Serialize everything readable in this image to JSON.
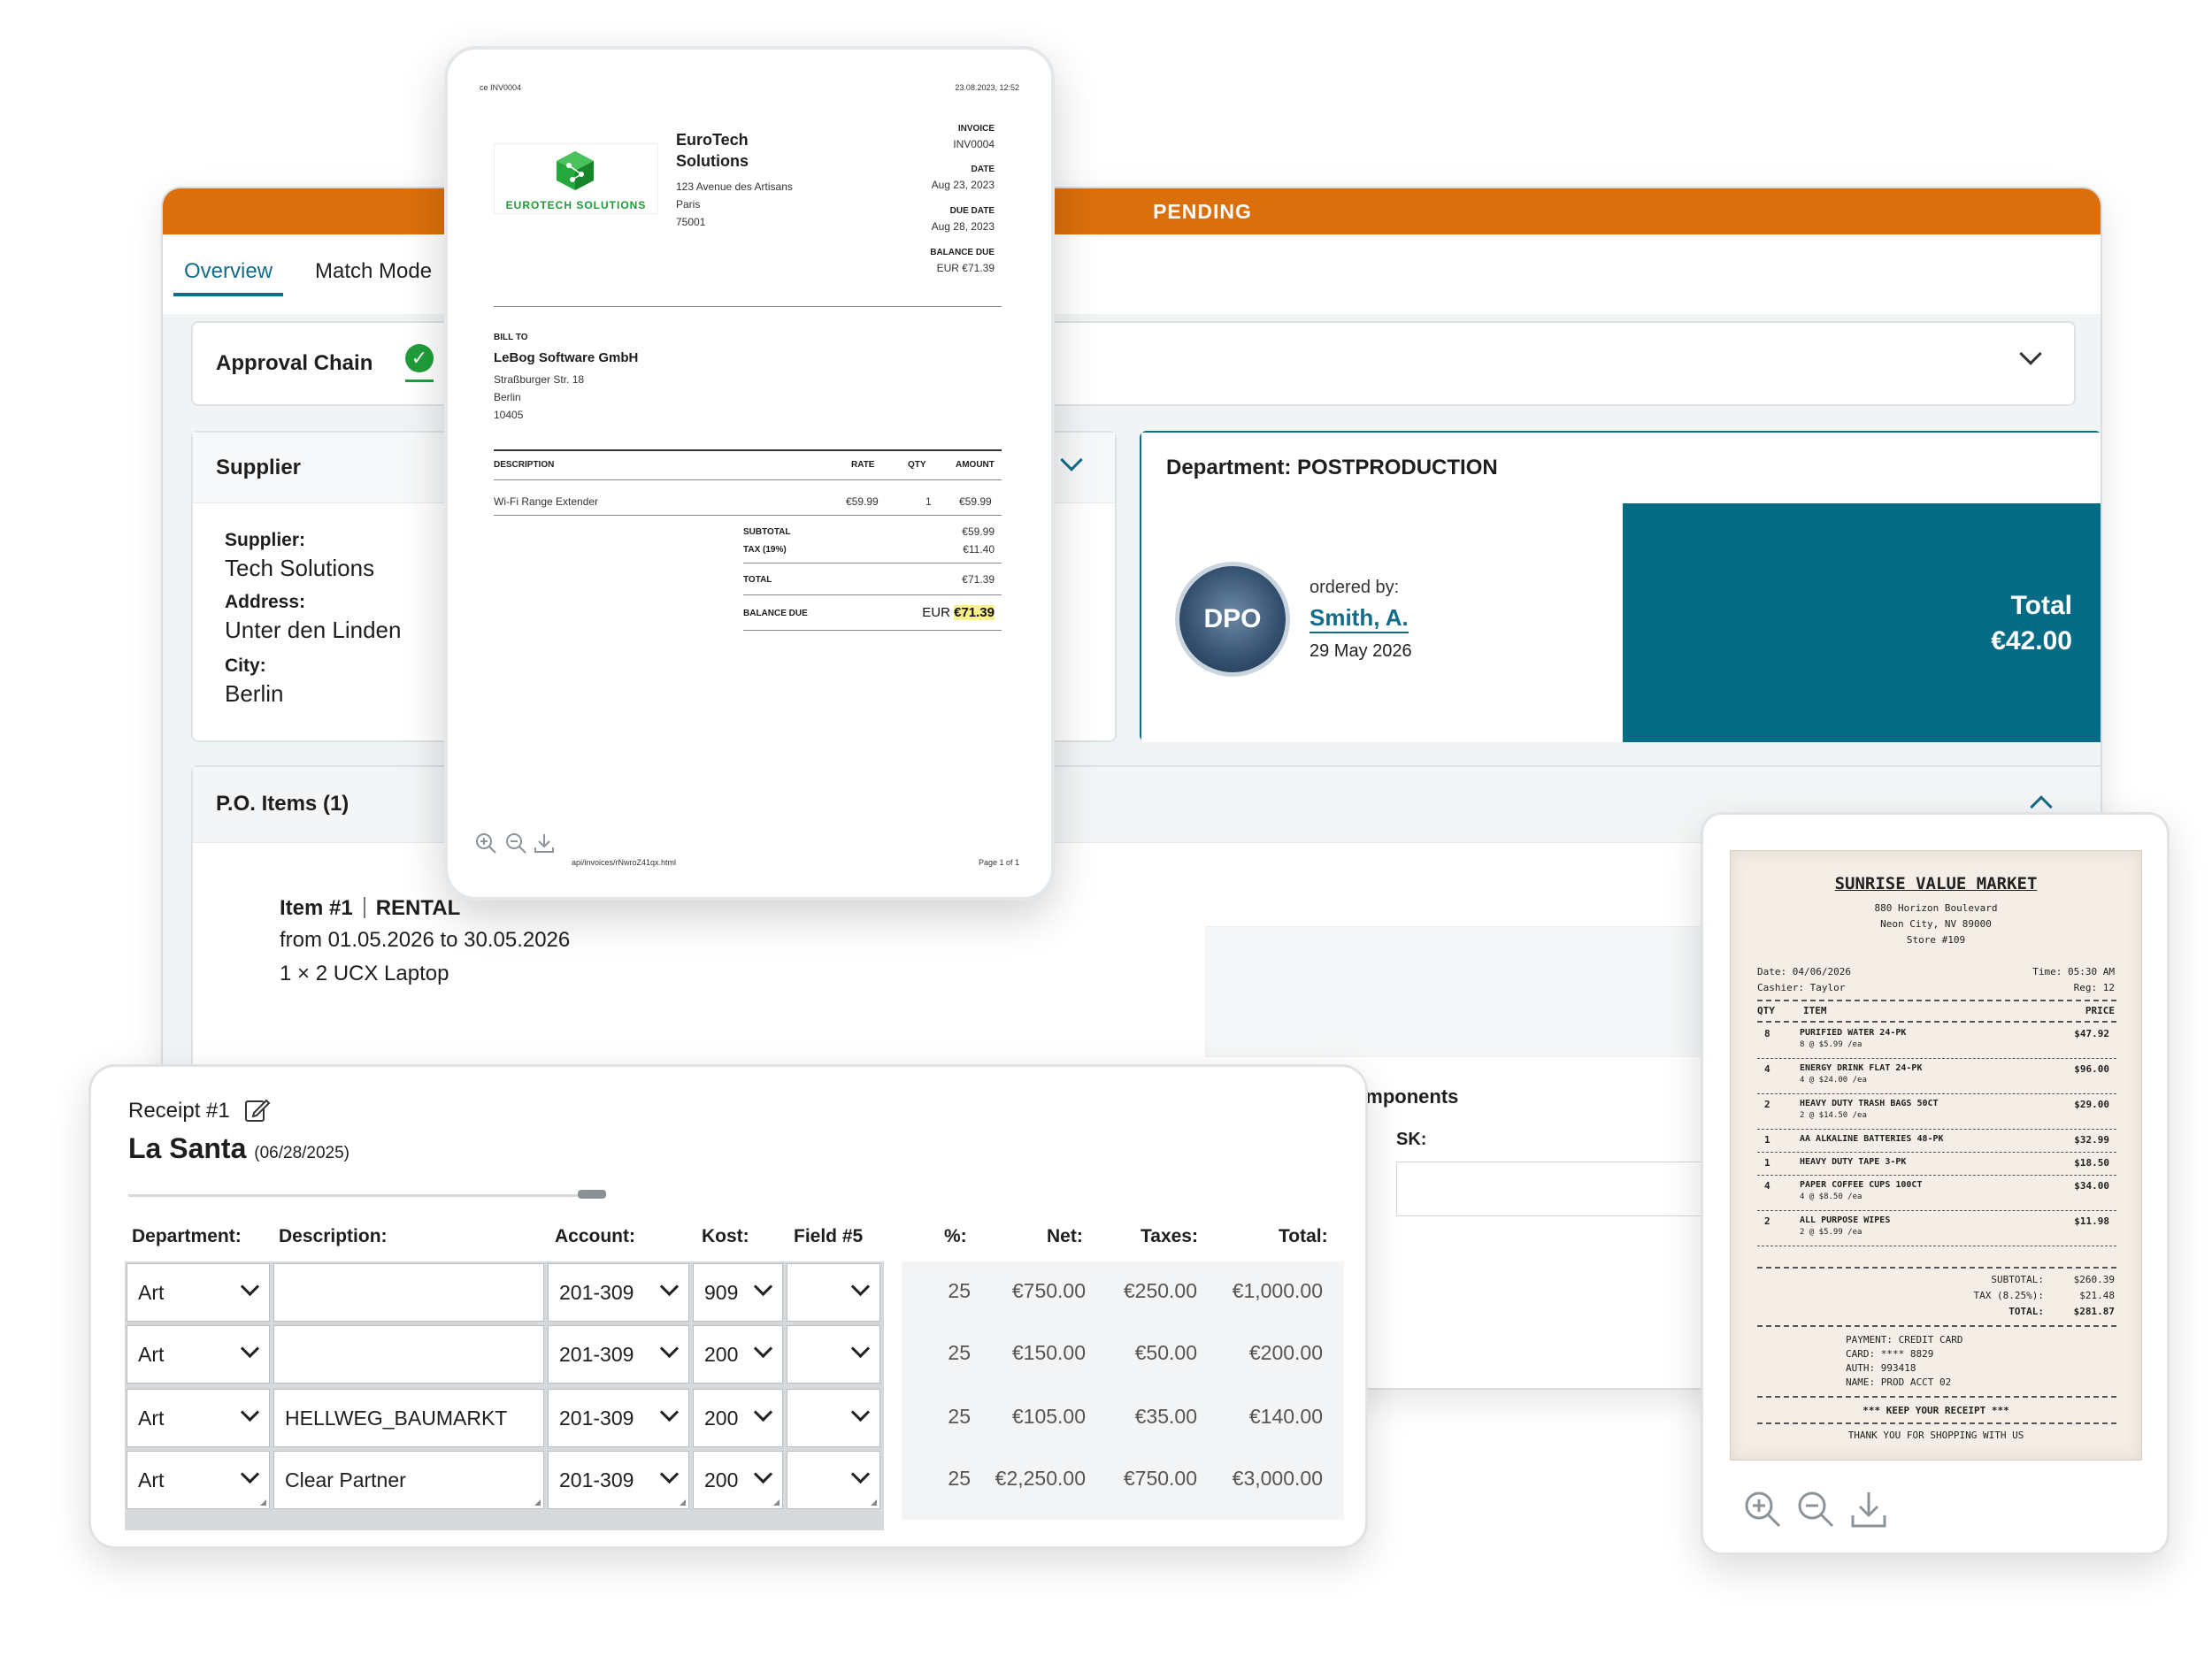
{
  "app": {
    "status": "PENDING",
    "tabs": [
      "Overview",
      "Match Mode"
    ],
    "approval_chain": {
      "label": "Approval Chain",
      "icon": "check-circle-icon"
    },
    "supplier": {
      "title": "Supplier",
      "supplier_label": "Supplier:",
      "supplier_value": "Tech Solutions",
      "address_label": "Address:",
      "address_value": "Unter den Linden",
      "city_label": "City:",
      "city_value": "Berlin"
    },
    "department": {
      "title": "Department: POSTPRODUCTION",
      "avatar_text": "DPO",
      "ordered_by_label": "ordered by:",
      "ordered_by_name": "Smith, A.",
      "ordered_date": "29 May 2026",
      "total_label": "Total",
      "total_value": "€42.00"
    },
    "po_items": {
      "title": "P.O. Items (1)",
      "item_number": "Item #1",
      "item_type": "RENTAL",
      "period": "from 01.05.2026 to 30.05.2026",
      "quantity_line": "1 × 2  UCX Laptop",
      "components_title": "P.O. Line Item Components",
      "components_field_label": "SK:"
    },
    "colors": {
      "status_bar": "#db6f0c",
      "accent": "#136b8a",
      "total_panel": "#066c86",
      "check": "#1f9d3a"
    }
  },
  "invoice": {
    "header_left": "ce INV0004",
    "header_right": "23.08.2023, 12:52",
    "logo_text": "EUROTECH SOLUTIONS",
    "company": "EuroTech Solutions",
    "address": [
      "123 Avenue des Artisans",
      "Paris",
      "75001"
    ],
    "meta": [
      {
        "label": "INVOICE",
        "value": "INV0004"
      },
      {
        "label": "DATE",
        "value": "Aug 23, 2023"
      },
      {
        "label": "DUE DATE",
        "value": "Aug 28, 2023"
      },
      {
        "label": "BALANCE DUE",
        "value": "EUR €71.39"
      }
    ],
    "bill_to_label": "BILL TO",
    "bill_to_name": "LeBog Software GmbH",
    "bill_to_address": [
      "Straßburger Str. 18",
      "Berlin",
      "10405"
    ],
    "columns": [
      "DESCRIPTION",
      "RATE",
      "QTY",
      "AMOUNT"
    ],
    "line": {
      "description": "Wi-Fi Range Extender",
      "rate": "€59.99",
      "qty": "1",
      "amount": "€59.99"
    },
    "subtotal_label": "SUBTOTAL",
    "subtotal": "€59.99",
    "tax_label": "TAX (19%)",
    "tax": "€11.40",
    "total_label": "TOTAL",
    "total": "€71.39",
    "balance_label": "BALANCE DUE",
    "balance_prefix": "EUR",
    "balance": "€71.39",
    "footer_url": "api/invoices/rNwroZ41qx.html",
    "footer_page": "Page 1 of 1"
  },
  "editor": {
    "receipt_label": "Receipt #1",
    "vendor": "La Santa",
    "date": "(06/28/2025)",
    "headers": [
      "Department:",
      "Description:",
      "Account:",
      "Kost:",
      "Field #5",
      "%:",
      "Net:",
      "Taxes:",
      "Total:"
    ],
    "rows": [
      {
        "department": "Art",
        "description": "",
        "account": "201-309",
        "kost": "909",
        "field5": "",
        "pct": "25",
        "net": "€750.00",
        "taxes": "€250.00",
        "total": "€1,000.00"
      },
      {
        "department": "Art",
        "description": "",
        "account": "201-309",
        "kost": "200",
        "field5": "",
        "pct": "25",
        "net": "€150.00",
        "taxes": "€50.00",
        "total": "€200.00"
      },
      {
        "department": "Art",
        "description": "HELLWEG_BAUMARKT",
        "account": "201-309",
        "kost": "200",
        "field5": "",
        "pct": "25",
        "net": "€105.00",
        "taxes": "€35.00",
        "total": "€140.00"
      },
      {
        "department": "Art",
        "description": "Clear Partner",
        "account": "201-309",
        "kost": "200",
        "field5": "",
        "pct": "25",
        "net": "€2,250.00",
        "taxes": "€750.00",
        "total": "€3,000.00"
      }
    ]
  },
  "receipt": {
    "store": "SUNRISE VALUE MARKET",
    "address": [
      "880 Horizon Boulevard",
      "Neon City, NV 89000",
      "Store #109"
    ],
    "date_line": "Date: 04/06/2026",
    "time_line": "Time: 05:30 AM",
    "cashier_line": "Cashier: Taylor",
    "reg_line": "Reg: 12",
    "col_qty": "QTY",
    "col_item": "ITEM",
    "col_price": "PRICE",
    "items": [
      {
        "qty": "8",
        "name": "PURIFIED WATER 24-PK",
        "sub": "8 @ $5.99 /ea",
        "price": "$47.92"
      },
      {
        "qty": "4",
        "name": "ENERGY DRINK FLAT 24-PK",
        "sub": "4 @ $24.00 /ea",
        "price": "$96.00"
      },
      {
        "qty": "2",
        "name": "HEAVY DUTY TRASH BAGS 50CT",
        "sub": "2 @ $14.50 /ea",
        "price": "$29.00"
      },
      {
        "qty": "1",
        "name": "AA ALKALINE BATTERIES 48-PK",
        "sub": "",
        "price": "$32.99"
      },
      {
        "qty": "1",
        "name": "HEAVY DUTY TAPE 3-PK",
        "sub": "",
        "price": "$18.50"
      },
      {
        "qty": "4",
        "name": "PAPER COFFEE CUPS 100CT",
        "sub": "4 @ $8.50 /ea",
        "price": "$34.00"
      },
      {
        "qty": "2",
        "name": "ALL PURPOSE WIPES",
        "sub": "2 @ $5.99 /ea",
        "price": "$11.98"
      }
    ],
    "subtotal_label": "SUBTOTAL:",
    "subtotal": "$260.39",
    "tax_label": "TAX (8.25%):",
    "tax": "$21.48",
    "total_label": "TOTAL:",
    "total": "$281.87",
    "payment": [
      "PAYMENT: CREDIT CARD",
      "CARD: **** 8829",
      "AUTH: 993418",
      "NAME: PROD ACCT 02"
    ],
    "keep": "*** KEEP YOUR RECEIPT ***",
    "thanks": "THANK YOU FOR SHOPPING WITH US"
  }
}
